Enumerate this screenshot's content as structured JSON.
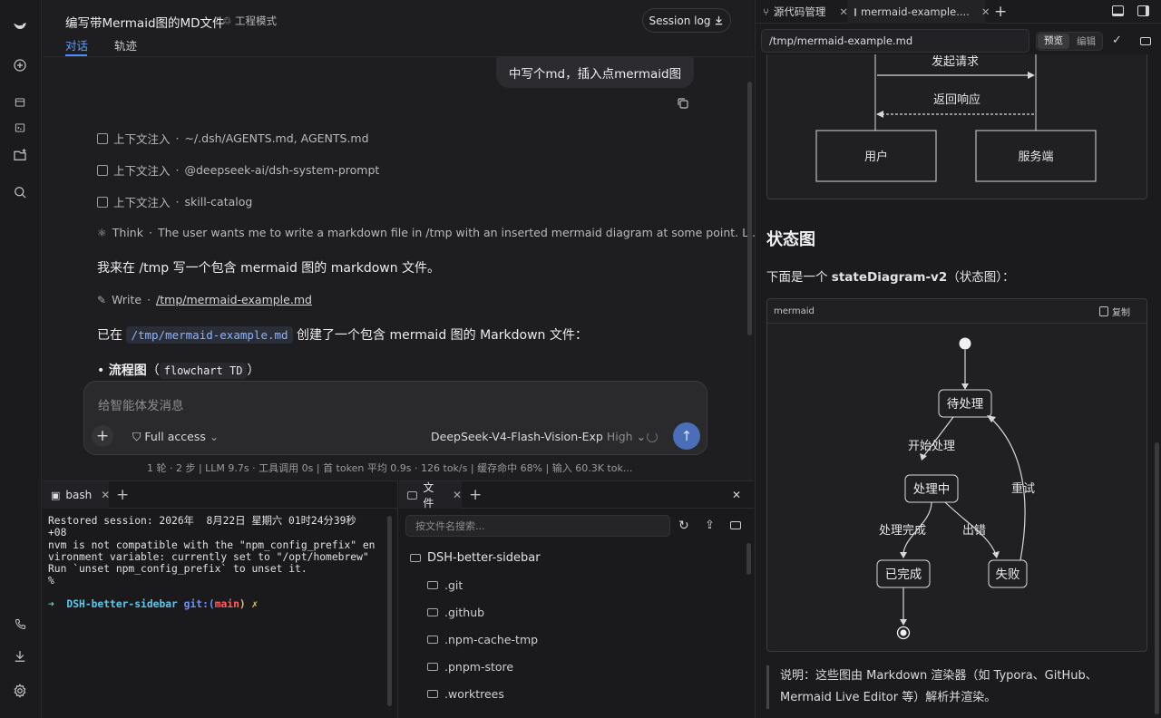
{
  "rail": {
    "icons": [
      "logo-icon",
      "new-chat-icon",
      "sidebar-icon",
      "terminal-icon",
      "add-project-icon",
      "search-icon",
      "phone-icon",
      "download-icon",
      "settings-icon"
    ]
  },
  "chat": {
    "title": "编写带Mermaid图的MD文件",
    "mode": "工程模式",
    "tabs": [
      "对话",
      "轨迹"
    ],
    "session_log": "Session log",
    "user_message": "中写个md，插入点mermaid图",
    "context_lines": [
      {
        "label": "上下文注入",
        "value": "~/.dsh/AGENTS.md, AGENTS.md"
      },
      {
        "label": "上下文注入",
        "value": "@deepseek-ai/dsh-system-prompt"
      },
      {
        "label": "上下文注入",
        "value": "skill-catalog"
      }
    ],
    "think_label": "Think",
    "think_text": "The user wants me to write a markdown file in /tmp with an inserted mermaid diagram at some point. L...",
    "reply_1": "我来在 /tmp 写一个包含 mermaid 图的 markdown 文件。",
    "write_label": "Write",
    "write_path": "/tmp/mermaid-example.md",
    "reply_2_pre": "已在",
    "reply_2_code": "/tmp/mermaid-example.md",
    "reply_2_post": "创建了一个包含 mermaid 图的 Markdown 文件：",
    "bullet_bold": "流程图",
    "bullet_code": "flowchart TD",
    "composer_placeholder": "给智能体发消息",
    "access": "Full access",
    "model": "DeepSeek-V4-Flash-Vision-Exp",
    "effort": "High",
    "stats": "1 轮 · 2 步   |   LLM 9.7s · 工具调用 0s   |   首 token 平均 0.9s · 126 tok/s   |   缓存命中 68%   |   输入 60.3K tok..."
  },
  "terminal": {
    "tab": "bash",
    "output": "Restored session: 2026年  8月22日 星期六 01时24分39秒\n+08\nnvm is not compatible with the \"npm_config_prefix\" en\nvironment variable: currently set to \"/opt/homebrew\"\nRun `unset npm_config_prefix` to unset it.\n%",
    "prompt_arrow": "➜",
    "prompt_dir": "DSH-better-sidebar",
    "prompt_git": "git:(",
    "prompt_branch": "main",
    "prompt_end": ") ✗"
  },
  "files": {
    "tab": "文件",
    "search_placeholder": "按文件名搜索...",
    "root": "DSH-better-sidebar",
    "items": [
      ".git",
      ".github",
      ".npm-cache-tmp",
      ".pnpm-store",
      ".worktrees"
    ]
  },
  "preview": {
    "tabs": [
      "源代码管理",
      "mermaid-example...."
    ],
    "path": "/tmp/mermaid-example.md",
    "view_modes": [
      "预览",
      "编辑"
    ],
    "seq": {
      "msg1": "发起请求",
      "msg2": "返回响应",
      "actor1": "用户",
      "actor2": "服务端"
    },
    "heading": "状态图",
    "desc_pre": "下面是一个 ",
    "desc_bold": "stateDiagram-v2",
    "desc_post": "（状态图）：",
    "code_lang": "mermaid",
    "copy": "复制",
    "state": {
      "s1": "待处理",
      "s2": "处理中",
      "s3": "已完成",
      "s4": "失败",
      "e1": "开始处理",
      "e2": "处理完成",
      "e3": "出错",
      "e4": "重试"
    },
    "note": "说明：这些图由 Markdown 渲染器（如 Typora、GitHub、Mermaid Live Editor 等）解析并渲染。"
  }
}
